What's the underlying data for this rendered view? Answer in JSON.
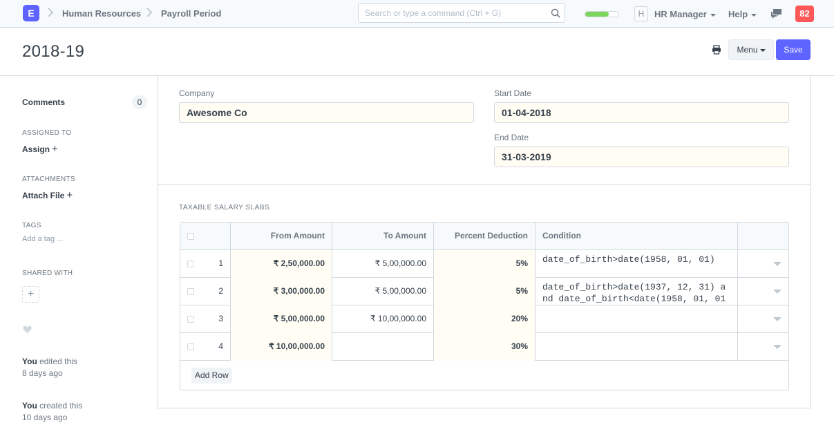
{
  "navbar": {
    "logo_letter": "E",
    "breadcrumbs": [
      "Human Resources",
      "Payroll Period"
    ],
    "search_placeholder": "Search or type a command (Ctrl + G)",
    "progress_fraction": 0.7,
    "avatar_letter": "H",
    "user_label": "HR Manager",
    "help_label": "Help",
    "notification_count": "82"
  },
  "page": {
    "title": "2018-19",
    "menu_label": "Menu",
    "save_label": "Save"
  },
  "sidebar": {
    "comments_label": "Comments",
    "comments_count": "0",
    "assigned_to_label": "ASSIGNED TO",
    "assign_action": "Assign",
    "attachments_label": "ATTACHMENTS",
    "attach_action": "Attach File",
    "tags_label": "TAGS",
    "add_tag": "Add a tag ...",
    "shared_with_label": "SHARED WITH",
    "share_plus": "+",
    "timeline": [
      {
        "actor": "You",
        "action": " edited this",
        "time": "8 days ago"
      },
      {
        "actor": "You",
        "action": " created this",
        "time": "10 days ago"
      }
    ]
  },
  "form": {
    "company_label": "Company",
    "company_value": "Awesome Co",
    "start_date_label": "Start Date",
    "start_date_value": "01-04-2018",
    "end_date_label": "End Date",
    "end_date_value": "31-03-2019",
    "section_title": "TAXABLE SALARY SLABS"
  },
  "table": {
    "columns": [
      "From Amount",
      "To Amount",
      "Percent Deduction",
      "Condition"
    ],
    "rows": [
      {
        "idx": "1",
        "from": "₹ 2,50,000.00",
        "to": "₹ 5,00,000.00",
        "percent": "5%",
        "condition": "date_of_birth>date(1958, 01, 01)"
      },
      {
        "idx": "2",
        "from": "₹ 3,00,000.00",
        "to": "₹ 5,00,000.00",
        "percent": "5%",
        "condition": "date_of_birth>date(1937, 12, 31) and date_of_birth<date(1958, 01, 01"
      },
      {
        "idx": "3",
        "from": "₹ 5,00,000.00",
        "to": "₹ 10,00,000.00",
        "percent": "20%",
        "condition": ""
      },
      {
        "idx": "4",
        "from": "₹ 10,00,000.00",
        "to": "",
        "percent": "30%",
        "condition": ""
      }
    ],
    "add_row_label": "Add Row"
  }
}
